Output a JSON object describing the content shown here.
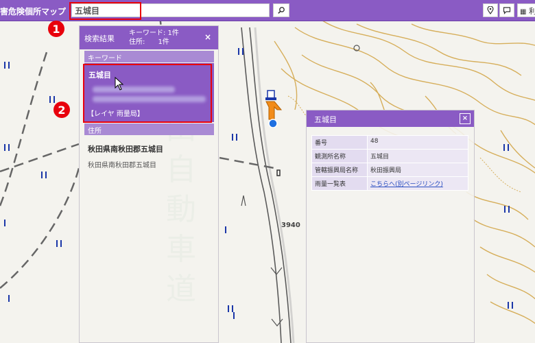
{
  "app": {
    "title": "害危険個所マップ"
  },
  "search": {
    "value": "五城目"
  },
  "toolbar": {
    "info_label": "利"
  },
  "steps": [
    "1",
    "2"
  ],
  "results_panel": {
    "title": "検索結果",
    "count_text": "キーワード: 1件\n住所:      1件",
    "close": "×",
    "keyword_section": "キーワード",
    "result_title": "五城目",
    "result_layer": "【レイヤ 雨量局】",
    "address_section": "住所",
    "address_title": "秋田県南秋田郡五城目",
    "address_sub": "秋田県南秋田郡五城目"
  },
  "popup": {
    "title": "五城目",
    "close": "×",
    "rows": [
      {
        "key": "番号",
        "value": "48"
      },
      {
        "key": "観測所名称",
        "value": "五城目"
      },
      {
        "key": "管轄振興局名称",
        "value": "秋田振興局"
      },
      {
        "key": "雨量一覧表",
        "value": "こちらへ(別ページリンク)"
      }
    ]
  },
  "map": {
    "road_text": "秋田自動車道",
    "elevation_label": "3940"
  },
  "colors": {
    "accent": "#8a5bc4",
    "highlight": "#e8000c",
    "contour": "#d6ae5a"
  }
}
